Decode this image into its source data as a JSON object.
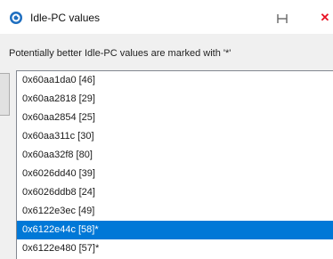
{
  "window": {
    "title": "Idle-PC values",
    "restore_glyph": "⊢⊣",
    "close_glyph": "✕",
    "icon": "gns3-chameleon-icon"
  },
  "dialog": {
    "prompt": "Potentially better Idle-PC values are marked with '*'"
  },
  "list": {
    "selected_index": 8,
    "items": [
      "0x60aa1da0 [46]",
      "0x60aa2818 [29]",
      "0x60aa2854 [25]",
      "0x60aa311c [30]",
      "0x60aa32f8 [80]",
      "0x6026dd40 [39]",
      "0x6026ddb8 [24]",
      "0x6122e3ec [49]",
      "0x6122e44c [58]*",
      "0x6122e480 [57]*"
    ]
  },
  "colors": {
    "selection": "#0078d7",
    "close": "#e81123",
    "icon_blue": "#1f6fc0"
  }
}
